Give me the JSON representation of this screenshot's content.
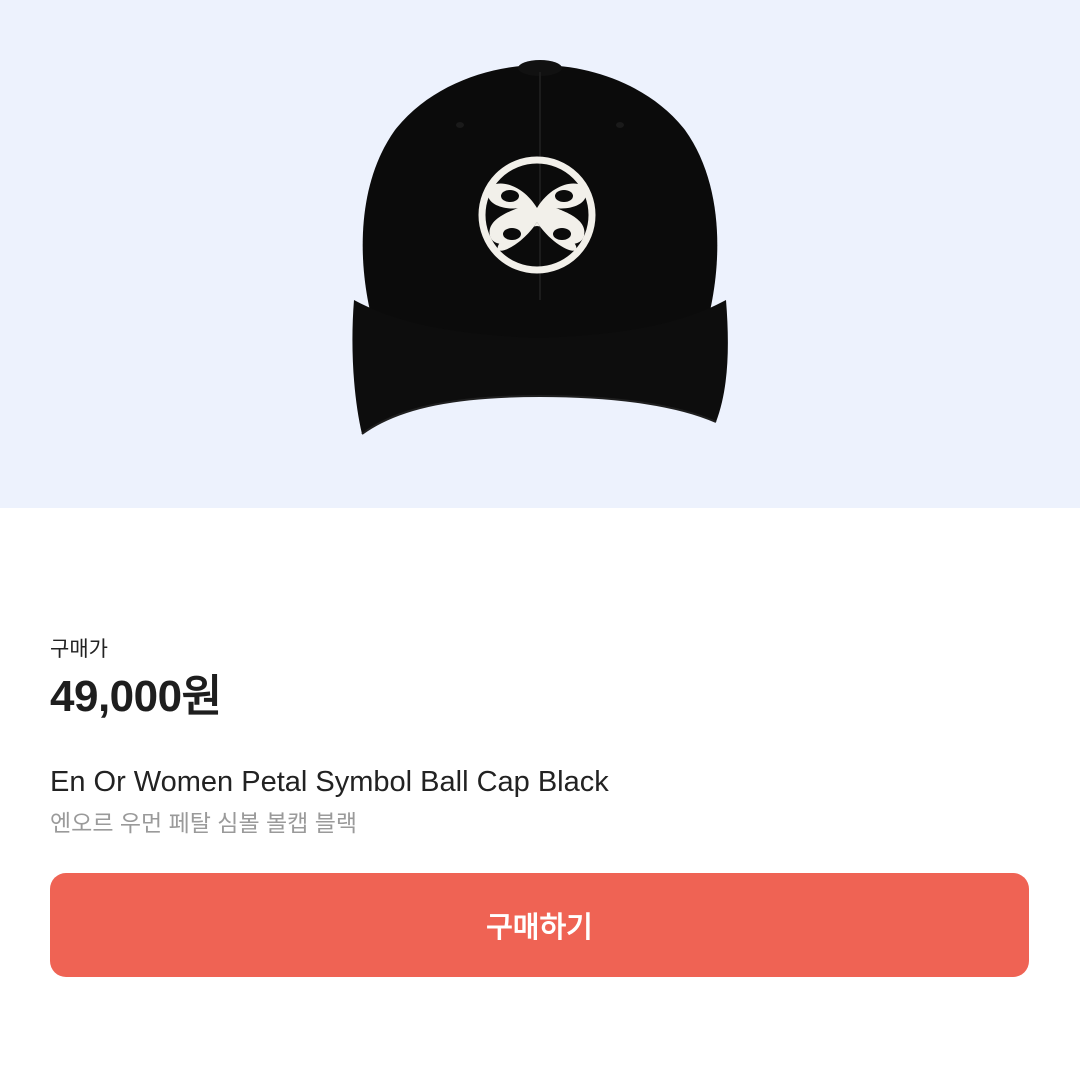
{
  "hero": {
    "background_color": "#edf2fd",
    "product_image": "black-ball-cap-with-white-petal-logo"
  },
  "product": {
    "price_label": "구매가",
    "price": "49,000원",
    "name_en": "En Or Women Petal Symbol Ball Cap Black",
    "name_ko": "엔오르 우먼 페탈 심볼 볼캡 블랙"
  },
  "actions": {
    "buy_label": "구매하기",
    "buy_color": "#ef6354"
  }
}
